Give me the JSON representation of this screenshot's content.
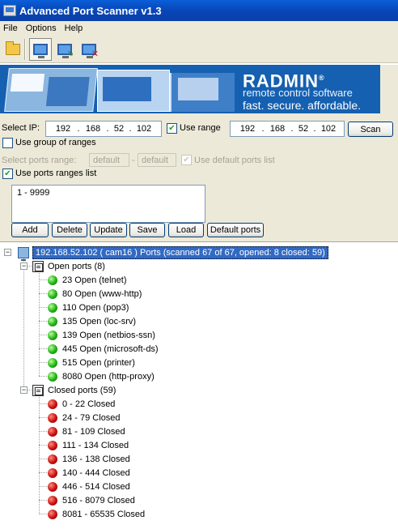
{
  "window": {
    "title": "Advanced Port Scanner v1.3"
  },
  "menu": [
    "File",
    "Options",
    "Help"
  ],
  "toolbar": {
    "icons": [
      "folder-open-icon",
      "scan-computer-icon",
      "scan-network-icon",
      "stop-scan-icon"
    ]
  },
  "banner": {
    "brand": "RADMIN",
    "registered": "®",
    "tagline1": "remote control software",
    "tagline2": "fast. secure. affordable."
  },
  "scan": {
    "select_ip_label": "Select IP:",
    "ip_start": [
      "192",
      "168",
      "52",
      "102"
    ],
    "use_range_label": "Use range",
    "use_range_checked": true,
    "ip_end": [
      "192",
      "168",
      "52",
      "102"
    ],
    "scan_button": "Scan",
    "use_group_label": "Use group of ranges",
    "use_group_checked": false,
    "ports_range_label": "Select ports range:",
    "port_from": "default",
    "port_to": "default",
    "range_separator": "-",
    "use_default_ports_label": "Use default ports list",
    "use_default_ports_checked": true,
    "use_ports_list_label": "Use ports ranges list",
    "use_ports_list_checked": true,
    "ports_list": [
      "1 - 9999"
    ],
    "buttons": {
      "add": "Add",
      "delete": "Delete",
      "update": "Update",
      "save": "Save",
      "load": "Load",
      "default_ports": "Default ports"
    }
  },
  "results": {
    "host_label": "192.168.52.102  ( cam16 )     Ports (scanned 67 of 67, opened: 8 closed: 59)",
    "open_group_label": "Open ports (8)",
    "open_ports": [
      "23 Open (telnet)",
      "80 Open (www-http)",
      "110 Open (pop3)",
      "135 Open (loc-srv)",
      "139 Open (netbios-ssn)",
      "445 Open (microsoft-ds)",
      "515 Open (printer)",
      "8080 Open (http-proxy)"
    ],
    "closed_group_label": "Closed ports (59)",
    "closed_ports": [
      "0 - 22 Closed",
      "24 - 79 Closed",
      "81 - 109 Closed",
      "111 - 134 Closed",
      "136 - 138 Closed",
      "140 - 444 Closed",
      "446 - 514 Closed",
      "516 - 8079 Closed",
      "8081 - 65535 Closed"
    ],
    "colors": {
      "open": "#22b114",
      "closed": "#c81010",
      "selection": "#316ac5"
    }
  }
}
